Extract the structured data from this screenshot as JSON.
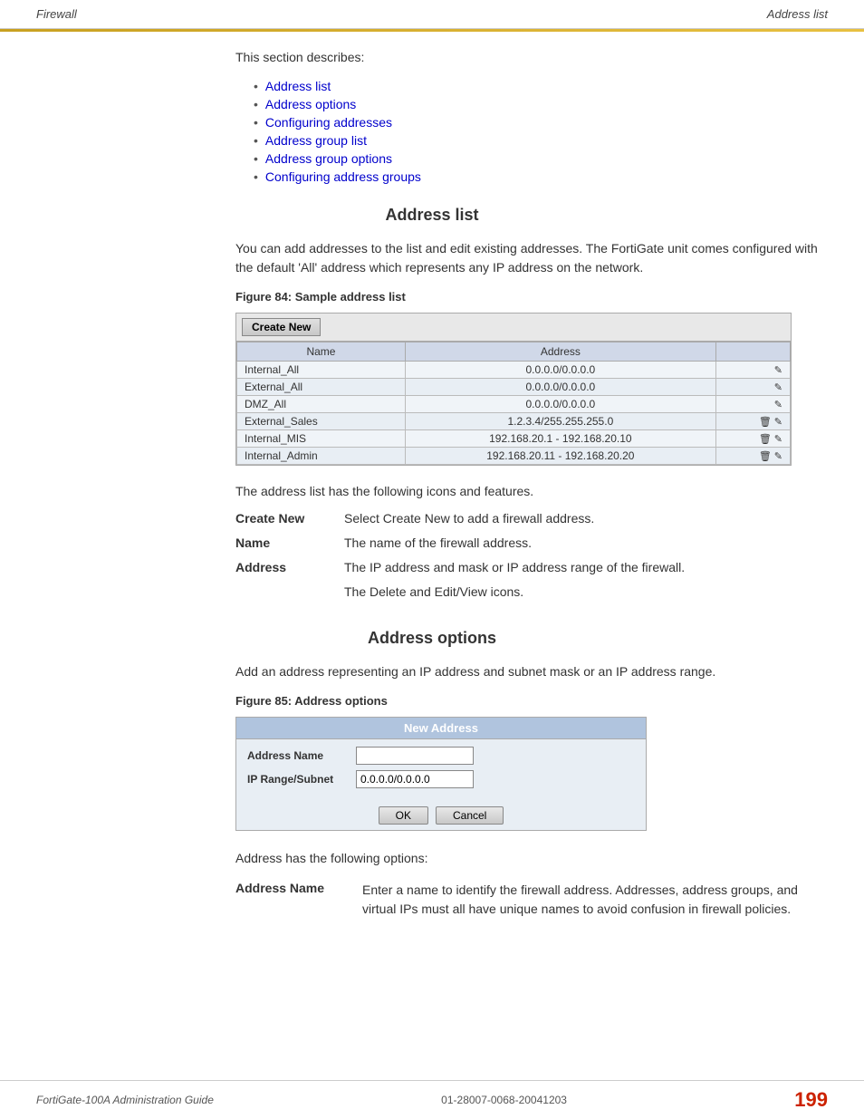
{
  "header": {
    "left": "Firewall",
    "right": "Address list",
    "accent_color": "#c8a020"
  },
  "intro": {
    "text": "This section describes:"
  },
  "toc": {
    "items": [
      {
        "label": "Address list",
        "href": "#address-list"
      },
      {
        "label": "Address options",
        "href": "#address-options"
      },
      {
        "label": "Configuring addresses",
        "href": "#configuring-addresses"
      },
      {
        "label": "Address group list",
        "href": "#address-group-list"
      },
      {
        "label": "Address group options",
        "href": "#address-group-options"
      },
      {
        "label": "Configuring address groups",
        "href": "#configuring-address-groups"
      }
    ]
  },
  "address_list_section": {
    "heading": "Address list",
    "body_text": "You can add addresses to the list and edit existing addresses. The FortiGate unit comes configured with the default 'All' address which represents any IP address on the network.",
    "figure_caption": "Figure 84: Sample address list",
    "create_new_label": "Create New",
    "table": {
      "columns": [
        "Name",
        "Address"
      ],
      "rows": [
        {
          "name": "Internal_All",
          "address": "0.0.0.0/0.0.0.0",
          "deletable": false
        },
        {
          "name": "External_All",
          "address": "0.0.0.0/0.0.0.0",
          "deletable": false
        },
        {
          "name": "DMZ_All",
          "address": "0.0.0.0/0.0.0.0",
          "deletable": false
        },
        {
          "name": "External_Sales",
          "address": "1.2.3.4/255.255.255.0",
          "deletable": true
        },
        {
          "name": "Internal_MIS",
          "address": "192.168.20.1 - 192.168.20.10",
          "deletable": true
        },
        {
          "name": "Internal_Admin",
          "address": "192.168.20.11 - 192.168.20.20",
          "deletable": true
        }
      ]
    },
    "features_intro": "The address list has the following icons and features.",
    "features": [
      {
        "term": "Create New",
        "def": "Select Create New to add a firewall address."
      },
      {
        "term": "Name",
        "def": "The name of the firewall address."
      },
      {
        "term": "Address",
        "def": "The IP address and mask or IP address range of the firewall."
      },
      {
        "term": "",
        "def": "The Delete and Edit/View icons."
      }
    ]
  },
  "address_options_section": {
    "heading": "Address options",
    "body_text": "Add an address representing an IP address and subnet mask or an IP address range.",
    "figure_caption": "Figure 85: Address options",
    "form": {
      "title": "New Address",
      "fields": [
        {
          "label": "Address Name",
          "value": "",
          "placeholder": ""
        },
        {
          "label": "IP Range/Subnet",
          "value": "0.0.0.0/0.0.0.0",
          "placeholder": "0.0.0.0/0.0.0.0"
        }
      ],
      "ok_label": "OK",
      "cancel_label": "Cancel"
    },
    "options_intro": "Address has the following options:",
    "address_name_term": "Address Name",
    "address_name_def": "Enter a name to identify the firewall address. Addresses, address groups, and virtual IPs must all have unique names to avoid confusion in firewall policies."
  },
  "footer": {
    "left": "FortiGate-100A Administration Guide",
    "center": "01-28007-0068-20041203",
    "page_number": "199"
  }
}
